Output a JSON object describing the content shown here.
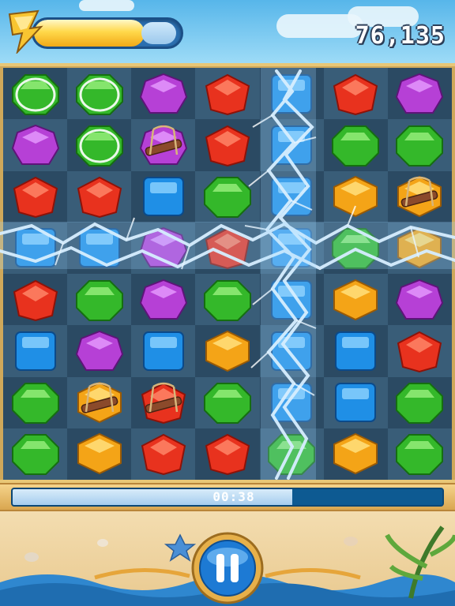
{
  "hud": {
    "score": "76,135",
    "energy_level": 0.75,
    "energy_icon": "lightning-bolt-icon"
  },
  "timer": {
    "time": "00:38",
    "remaining_fraction": 0.65
  },
  "controls": {
    "pause_icon": "pause-icon"
  },
  "board": {
    "columns": 7,
    "rows": 8,
    "tiles": [
      [
        "green-ring",
        "green-ring",
        "purple",
        "red",
        "blue",
        "red",
        "purple"
      ],
      [
        "purple",
        "green-ring",
        "purple-rope",
        "red",
        "blue",
        "green",
        "green"
      ],
      [
        "red",
        "red",
        "blue",
        "green",
        "blue",
        "orange",
        "orange-rope"
      ],
      [
        "blue",
        "blue",
        "purple",
        "red",
        "blue",
        "green",
        "orange"
      ],
      [
        "red",
        "green",
        "purple",
        "green",
        "blue",
        "orange",
        "purple"
      ],
      [
        "blue",
        "purple",
        "blue",
        "orange",
        "blue",
        "blue",
        "red"
      ],
      [
        "green",
        "orange-rope",
        "red-rope",
        "green",
        "blue",
        "blue",
        "green"
      ],
      [
        "green",
        "orange",
        "red",
        "red",
        "green",
        "orange",
        "green"
      ]
    ]
  },
  "colors": {
    "red": "#e8321e",
    "green": "#34b82a",
    "blue": "#1f8fe6",
    "purple": "#b640d6",
    "orange": "#f4a417",
    "lightning": "#e9f6ff"
  }
}
